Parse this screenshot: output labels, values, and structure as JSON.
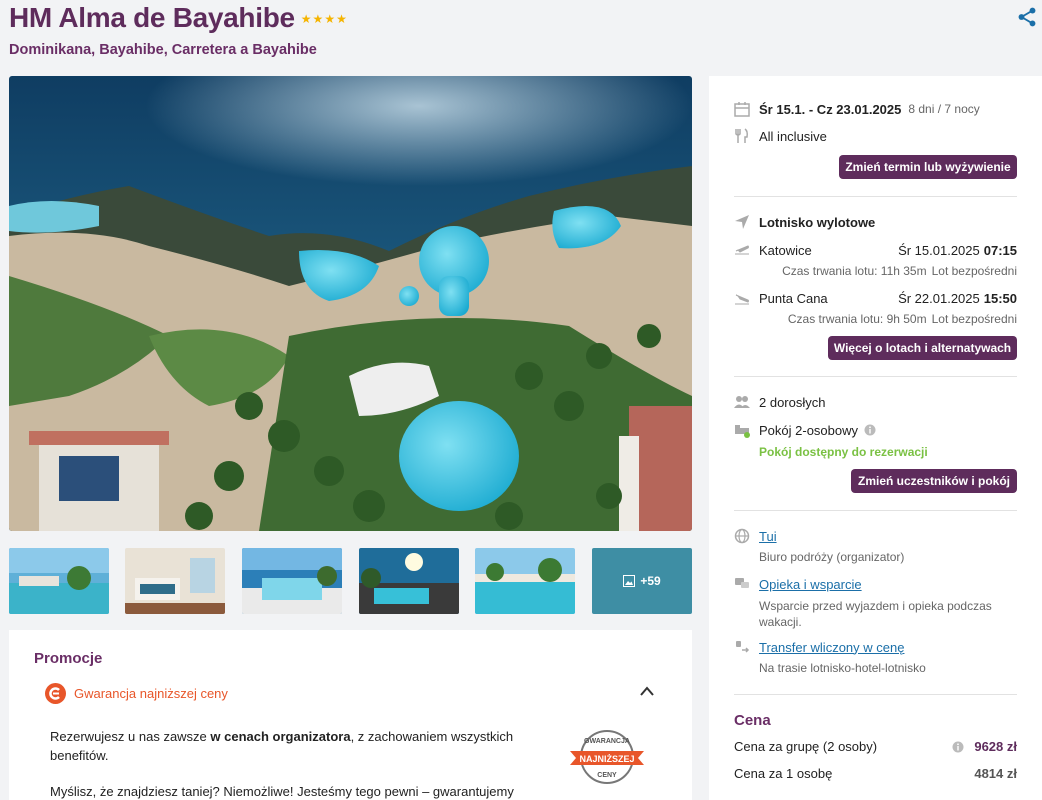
{
  "hotel": {
    "name": "HM Alma de Bayahibe",
    "stars": "★★★★",
    "location": "Dominikana, Bayahibe, Carretera a Bayahibe"
  },
  "gallery": {
    "more_label": "+59"
  },
  "promo": {
    "heading": "Promocje",
    "guarantee_label": "Gwarancja najniższej ceny",
    "p1_before": "Rezerwujesz u nas zawsze ",
    "p1_bold": "w cenach organizatora",
    "p1_after": ", z zachowaniem wszystkich benefitów.",
    "p2": "Myślisz, że znajdziesz taniej? Niemożliwe! Jesteśmy tego pewni – gwarantujemy",
    "badge_top": "GWARANCJA",
    "badge_mid": "NAJNIŻSZEJ",
    "badge_bottom": "CENY"
  },
  "booking": {
    "dates": "Śr 15.1. - Cz 23.01.2025",
    "duration": "8 dni / 7 nocy",
    "board": "All inclusive",
    "change_term_button": "Zmień termin lub wyżywienie",
    "airport_label": "Lotnisko wylotowe",
    "outbound": {
      "city": "Katowice",
      "date": "Śr 15.01.2025",
      "time": "07:15",
      "duration": "Czas trwania lotu: 11h 35m",
      "type": "Lot bezpośredni"
    },
    "inbound": {
      "city": "Punta Cana",
      "date": "Śr 22.01.2025",
      "time": "15:50",
      "duration": "Czas trwania lotu: 9h 50m",
      "type": "Lot bezpośredni"
    },
    "more_flights_button": "Więcej o lotach i alternatywach",
    "travellers": "2 dorosłych",
    "room": "Pokój 2-osobowy",
    "room_status": "Pokój dostępny do rezerwacji",
    "change_participants_button": "Zmień uczestników i pokój",
    "organizer_name": "Tui",
    "organizer_desc": "Biuro podróży (organizator)",
    "support_link": "Opieka i wsparcie",
    "support_desc": "Wsparcie przed wyjazdem i opieka podczas wakacji.",
    "transfer_link": "Transfer wliczony w cenę",
    "transfer_desc": "Na trasie lotnisko-hotel-lotnisko",
    "price_heading": "Cena",
    "price_group_label": "Cena za grupę (2 osoby)",
    "price_group_value": "9628 zł",
    "price_person_label": "Cena za 1 osobę",
    "price_person_value": "4814 zł"
  }
}
